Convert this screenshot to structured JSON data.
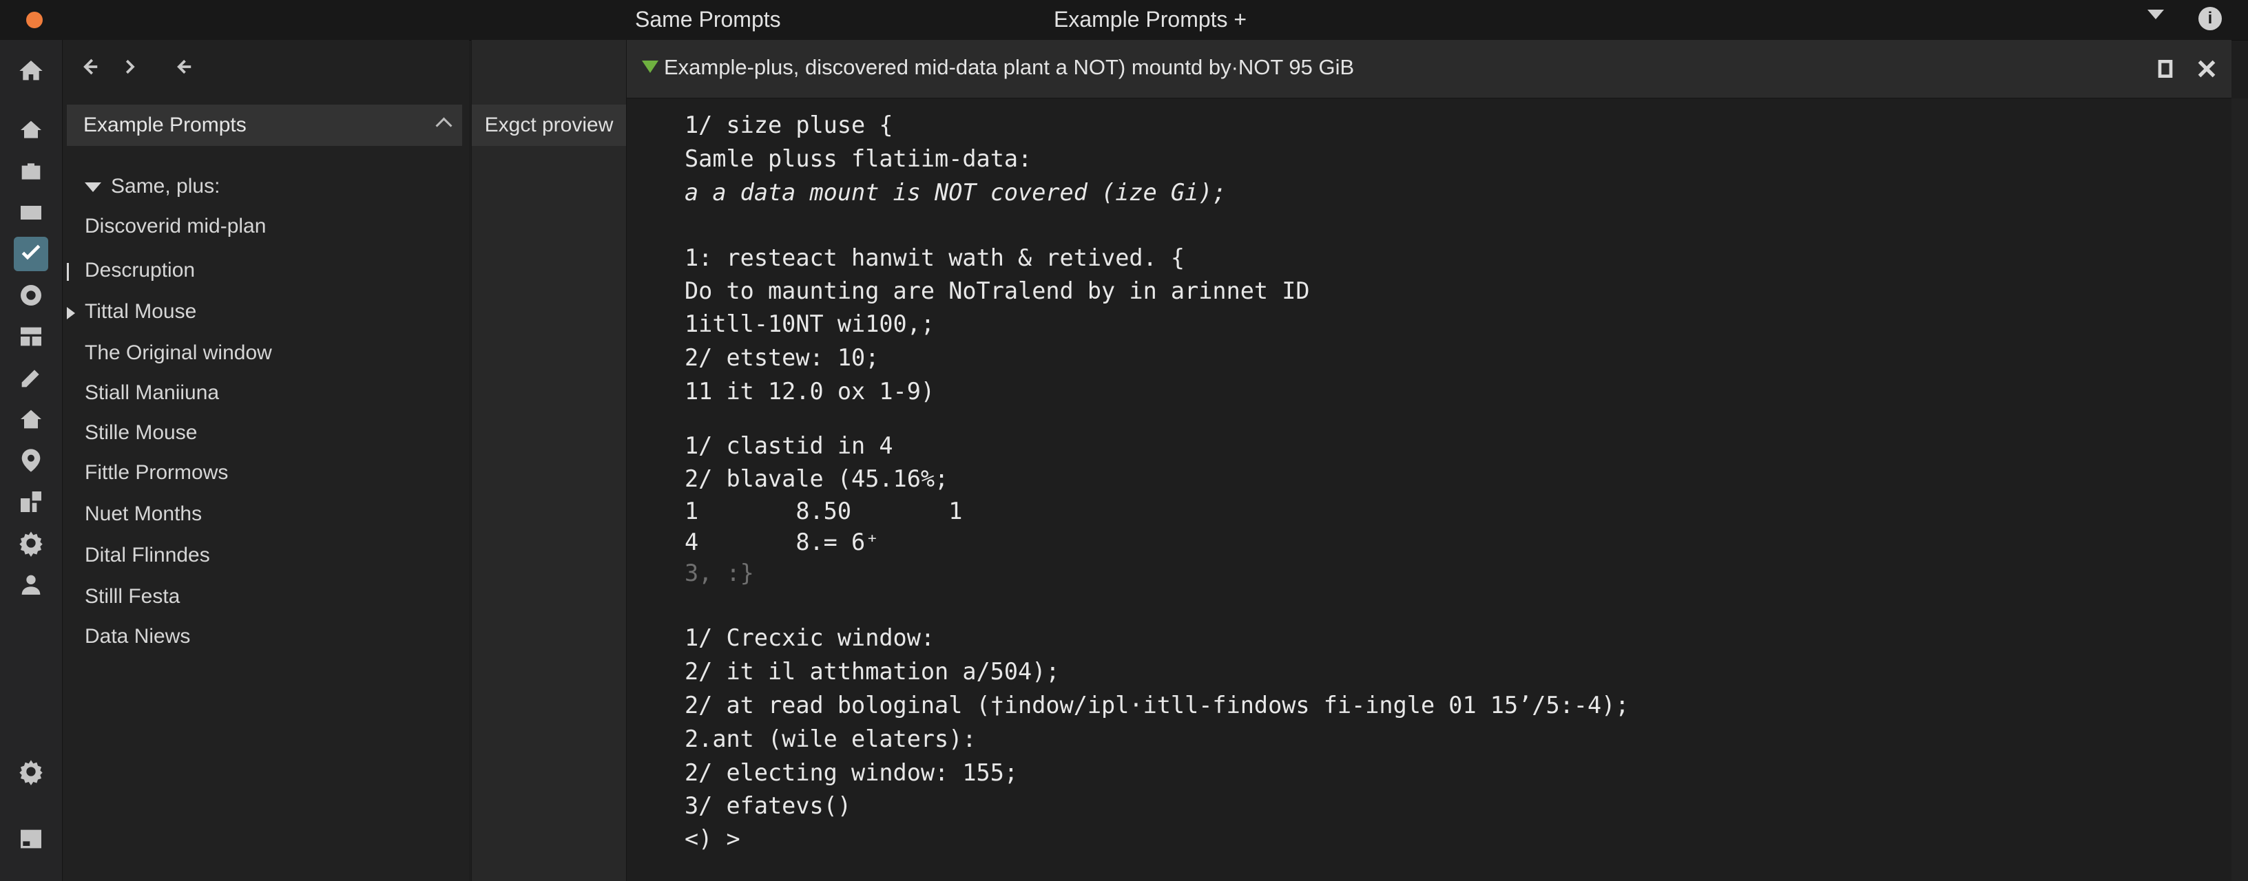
{
  "titlebar": {
    "left_title": "Same Prompts",
    "right_title": "Example Prompts +",
    "info_label": "i",
    "traffic_color": "#f07d3c"
  },
  "activity_bar": {
    "icons": [
      "home-icon",
      "explorer-icon",
      "briefcase-icon",
      "window-icon",
      "checkmark-icon",
      "settings-circle-icon",
      "layout-icon",
      "pencil-icon",
      "house-icon",
      "location-icon",
      "extensions-icon",
      "gear-icon",
      "account-icon",
      "settings-bottom-icon",
      "panel-icon"
    ],
    "active_color": "#4c7483"
  },
  "sidebar": {
    "header": "Example Prompts",
    "items": [
      "Same, plus:",
      "Discoverid mid-plan",
      "Descruption",
      "Tittal Mouse",
      "The Original window",
      "Stiall Maniiuna",
      "Stille Mouse",
      "Fittle Prormows",
      "Nuet Months",
      "Dital Flinndes",
      "Stilll Festa",
      "Data Niews"
    ]
  },
  "panel2": {
    "header": "Exgct proview"
  },
  "editor": {
    "tab_title": "Example-plus, discovered mid-data plant a NOT) mountd by·NOT 95 GiB",
    "lines": [
      "1/ size pluse {",
      "Samle pluss flatiim-data:",
      "a a data mount is NOT covered (ize Gi);",
      "1: resteact hanwit wath & retived. {",
      "Do to maunting are NoTralend by in arinnet ID",
      "1itll-10NT wi100,;",
      "2/ etstew: 10;",
      "11 it 12.0 ox 1-9)",
      "1/ clastid in 4",
      "2/ blavale (45.16%;",
      "1       8.50       1",
      "4       8.= 6⁺",
      "3, :}",
      "1/ Crecxic window:",
      "2/ it il atthmation a/504);",
      "2/ at read bologinal (†indow/ipl·itll-findows fi-ingle 01 15ʼ/5:-4);",
      "2.ant (wile elaters):",
      "2/ electing window: 155;",
      "3/ efatevs()",
      "<) >"
    ]
  }
}
